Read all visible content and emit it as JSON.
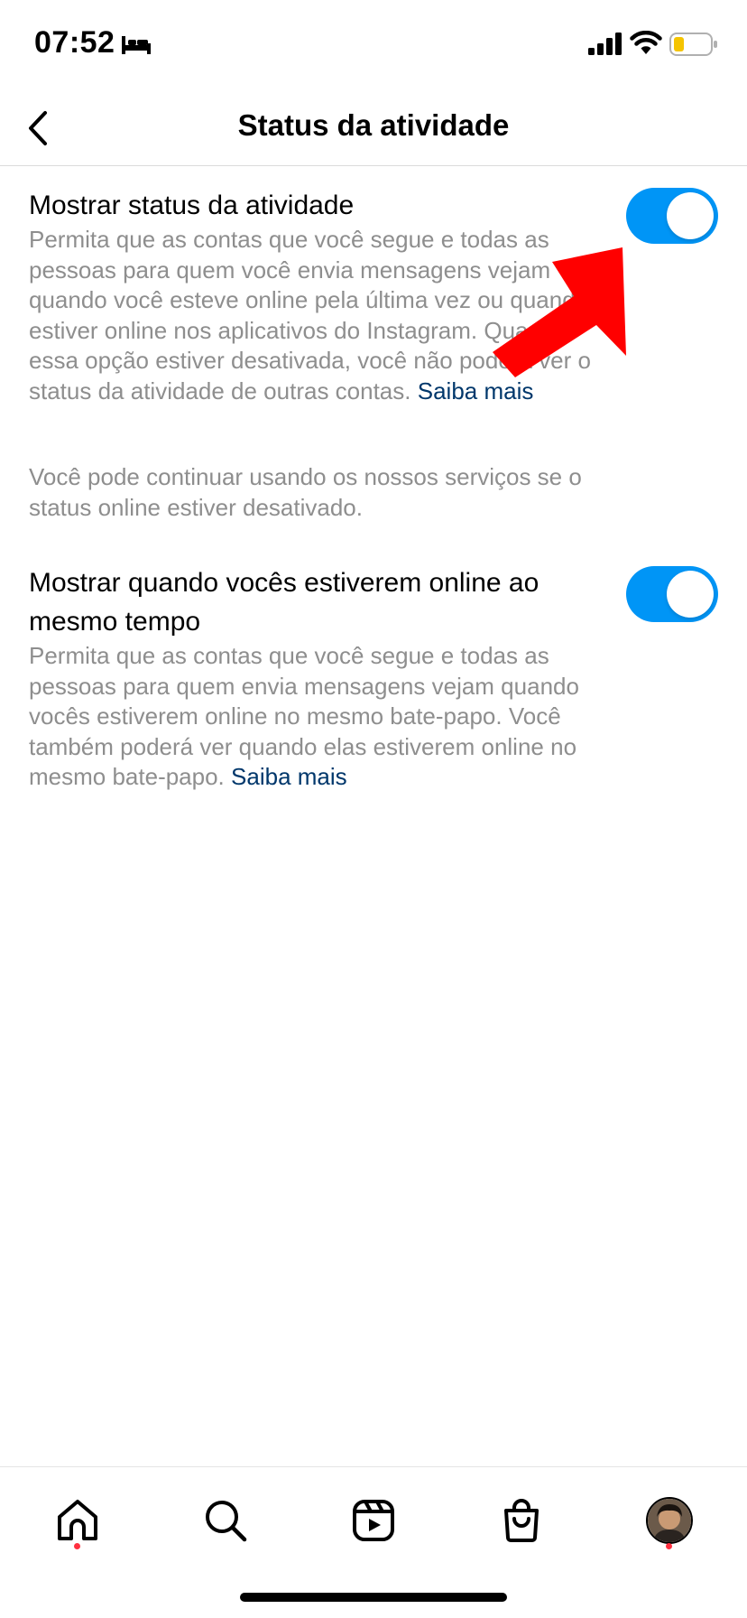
{
  "status_bar": {
    "time": "07:52",
    "icons": [
      "bed-icon",
      "signal-icon",
      "wifi-icon",
      "battery-icon"
    ],
    "battery_color": "#f5c400"
  },
  "header": {
    "title": "Status da atividade",
    "back_icon": "chevron-left-icon"
  },
  "settings": [
    {
      "title": "Mostrar status da atividade",
      "description": "Permita que as contas que você segue e todas as pessoas para quem você envia mensagens vejam quando você esteve online pela última vez ou quando estiver online nos aplicativos do Instagram. Quando essa opção estiver desativada, você não poderá ver o status da atividade de outras contas.",
      "learn_more": "Saiba mais",
      "enabled": true
    },
    {
      "title": "Mostrar quando vocês estiverem online ao mesmo tempo",
      "description": "Permita que as contas que você segue e todas as pessoas para quem envia mensagens vejam quando vocês estiverem online no mesmo bate-papo. Você também poderá ver quando elas estiverem online no mesmo bate-papo.",
      "learn_more": "Saiba mais",
      "enabled": true
    }
  ],
  "note": "Você pode continuar usando os nossos serviços se o status online estiver desativado.",
  "bottom_nav": {
    "items": [
      "home-icon",
      "search-icon",
      "reels-icon",
      "shop-icon",
      "profile-avatar"
    ],
    "notification_dot_color": "#ff3040"
  },
  "colors": {
    "accent": "#0095f6",
    "link": "#00376b",
    "secondary_text": "#8e8e8e",
    "annotation": "#ff0000"
  }
}
